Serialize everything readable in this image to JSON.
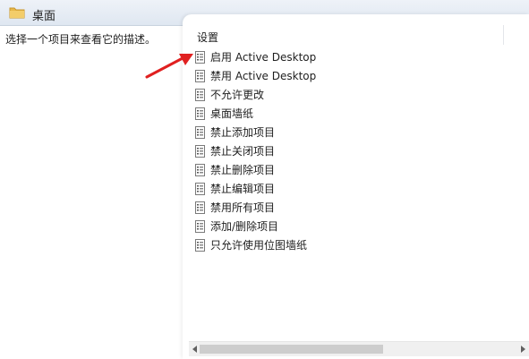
{
  "header": {
    "title": "桌面",
    "icon": "folder-icon"
  },
  "left_pane": {
    "description": "选择一个项目来查看它的描述。"
  },
  "right_pane": {
    "column_header": "设置",
    "items": [
      {
        "label": "启用 Active Desktop"
      },
      {
        "label": "禁用 Active Desktop"
      },
      {
        "label": "不允许更改"
      },
      {
        "label": "桌面墙纸"
      },
      {
        "label": "禁止添加项目"
      },
      {
        "label": "禁止关闭项目"
      },
      {
        "label": "禁止删除项目"
      },
      {
        "label": "禁止编辑项目"
      },
      {
        "label": "禁用所有项目"
      },
      {
        "label": "添加/删除项目"
      },
      {
        "label": "只允许使用位图墙纸"
      }
    ],
    "item_icon": "policy-document-icon"
  },
  "colors": {
    "annotation_arrow": "#e02020",
    "folder": "#e8b84a"
  }
}
